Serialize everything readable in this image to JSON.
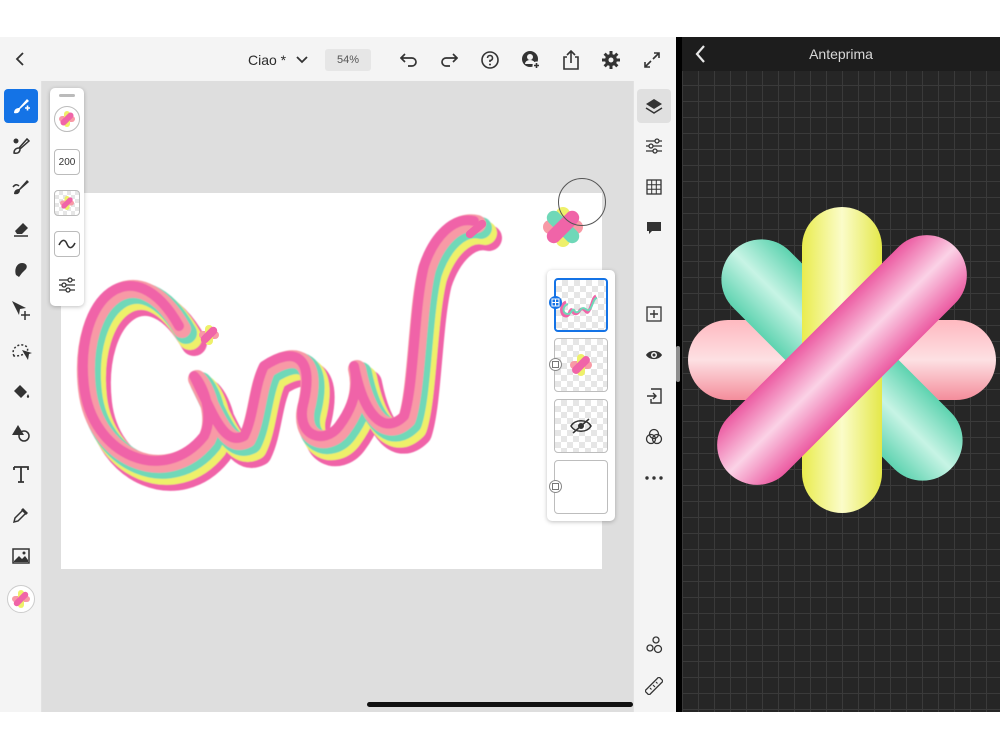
{
  "document": {
    "title": "Ciao *",
    "zoom": "54%"
  },
  "brush_panel": {
    "size_value": "200"
  },
  "preview": {
    "title": "Anteprima"
  },
  "icons": {
    "back": "chevron-left-icon",
    "undo": "undo-icon",
    "redo": "redo-icon",
    "help": "help-icon",
    "share": "share-icon",
    "settings": "gear-icon",
    "fullscreen": "expand-icon"
  },
  "colors": {
    "accent": "#1473e6",
    "pink": "#f064a8",
    "yellow": "#eef06a",
    "mint": "#6fd8b8",
    "coral": "#f89aa6"
  },
  "art": {
    "text": "Ciao"
  }
}
